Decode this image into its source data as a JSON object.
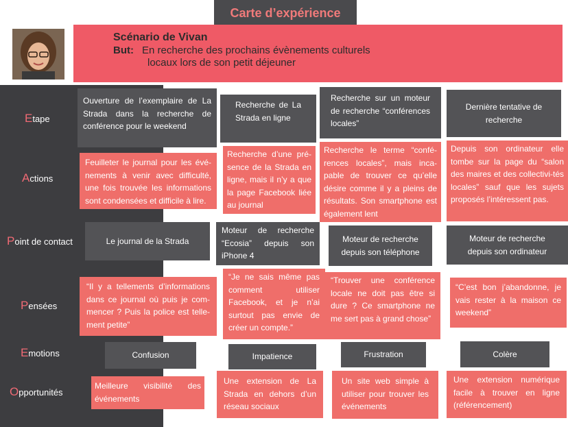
{
  "title": "Carte d’expérience",
  "persona": {
    "scenario": "Scénario de Vivan",
    "goal_label": "But:",
    "goal_line1": "En recherche des prochains évènements culturels",
    "goal_line2": "locaux lors de son petit déjeuner"
  },
  "rows": {
    "etape": {
      "cap": "E",
      "rest": "tape"
    },
    "actions": {
      "cap": "A",
      "rest": "ctions"
    },
    "contact": {
      "cap": "P",
      "rest": "oint de contact"
    },
    "pensees": {
      "cap": "P",
      "rest": "ensées"
    },
    "emotions": {
      "cap": "E",
      "rest": "motions"
    },
    "opportunites": {
      "cap": "O",
      "rest": "pportunités"
    }
  },
  "etapes": [
    "Ouverture de l’exemplaire de La Strada dans la recherche de conférence pour le weekend",
    "Recherche de La Strada en ligne",
    "Recherche sur un moteur de recherche “conférences locales”",
    "Dernière tentative de recherche"
  ],
  "actions": [
    "Feuilleter le journal pour les évé-nements à venir avec difficulté, une fois trouvée les informations sont condensées et difficile à lire.",
    "Recherche d’une pré-sence de la Strada en ligne, mais il n’y a que la page Facebook liée au journal",
    "Recherche le terme “confé-rences locales”, mais inca-pable de trouver ce qu’elle désire comme il y a pleins de résultats. Son smartphone est également lent",
    "Depuis son ordinateur elle tombe sur la page du “salon des maires et des collectivi-tés locales” sauf que les sujets proposés l’intéressent pas."
  ],
  "contacts": [
    "Le journal de la Strada",
    "Moteur de recherche “Ecosia” depuis son iPhone 4",
    "Moteur de recherche depuis son téléphone",
    "Moteur de recherche depuis son ordinateur"
  ],
  "pensees": [
    "“Il y a tellements d’informations dans ce journal où puis je com-mencer ? Puis la police est telle-ment petite”",
    "“Je ne sais même pas comment utiliser Facebook, et je n’ai surtout pas envie de créer un compte.”",
    "“Trouver une conférence locale ne doit pas être si dure ? Ce smartphone ne me sert pas à grand chose”",
    "“C’est bon j’abandonne, je vais rester à la maison ce weekend”"
  ],
  "emotions": [
    "Confusion",
    "Impatience",
    "Frustration",
    "Colère"
  ],
  "opportunites": [
    "Meilleure visibilité des événements",
    "Une extension de La Strada en dehors d’un réseau sociaux",
    "Un site web simple à utiliser pour trouver les événements",
    "Une extension numérique facile à trouver en ligne (référencement)"
  ],
  "colors": {
    "dark_box": "#535356",
    "coral_box": "#ef6e6a",
    "banner": "#ef5a66",
    "sidebar": "#3d3d40",
    "accent": "#f06a74"
  }
}
